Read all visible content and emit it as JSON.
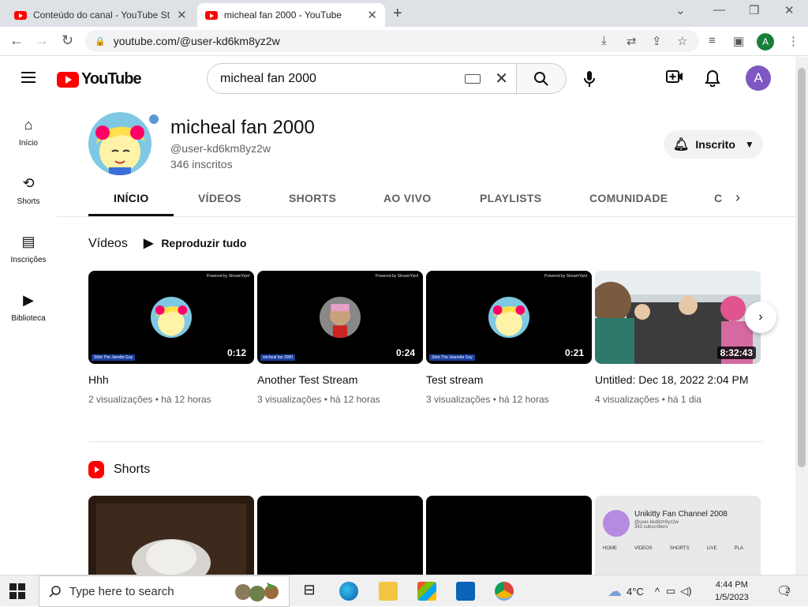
{
  "browser": {
    "tabs": [
      {
        "title": "Conteúdo do canal - YouTube St",
        "active": false
      },
      {
        "title": "micheal fan 2000 - YouTube",
        "active": true
      }
    ],
    "url": "youtube.com/@user-kd6km8yz2w",
    "profile_initial": "A"
  },
  "yt": {
    "logo_text": "YouTube",
    "search_query": "micheal fan 2000",
    "avatar_initial": "A",
    "guide": [
      {
        "label": "Início",
        "icon": "home-icon"
      },
      {
        "label": "Shorts",
        "icon": "shorts-icon"
      },
      {
        "label": "Inscrições",
        "icon": "subscriptions-icon"
      },
      {
        "label": "Biblioteca",
        "icon": "library-icon"
      }
    ]
  },
  "channel": {
    "name": "micheal fan 2000",
    "handle": "@user-kd6km8yz2w",
    "subscribers": "346 inscritos",
    "subscribe_label": "Inscrito",
    "tabs": [
      "INÍCIO",
      "VÍDEOS",
      "SHORTS",
      "AO VIVO",
      "PLAYLISTS",
      "COMUNIDADE",
      "C"
    ],
    "active_tab": "INÍCIO"
  },
  "videos_section": {
    "title": "Vídeos",
    "play_all": "Reproduzir tudo",
    "items": [
      {
        "title": "Hhh",
        "duration": "0:12",
        "views": "2 visualizações",
        "age": "há 12 horas",
        "tag": "Stick The Janette Guy",
        "brand": "Powered by StreamYard"
      },
      {
        "title": "Another Test Stream",
        "duration": "0:24",
        "views": "3 visualizações",
        "age": "há 12 horas",
        "tag": "micheal fan 2000",
        "brand": "Powered by StreamYard"
      },
      {
        "title": "Test stream",
        "duration": "0:21",
        "views": "3 visualizações",
        "age": "há 12 horas",
        "tag": "Stick The Jeanette Guy",
        "brand": "Powered by StreamYard"
      },
      {
        "title": "Untitled: Dec 18, 2022 2:04 PM",
        "duration": "8:32:43",
        "views": "4 visualizações",
        "age": "há 1 dia"
      }
    ]
  },
  "shorts_section": {
    "title": "Shorts",
    "preview_channel": "Unikitty Fan Channel 2008",
    "preview_handle": "@user-kkd8zh9yz2w",
    "preview_subs": "343 subscribers",
    "preview_tabs": [
      "HOME",
      "VIDEOS",
      "SHORTS",
      "LIVE",
      "PLA"
    ]
  },
  "taskbar": {
    "search_placeholder": "Type here to search",
    "weather": "4°C",
    "time": "4:44 PM",
    "date": "1/5/2023",
    "notifications": "2"
  }
}
